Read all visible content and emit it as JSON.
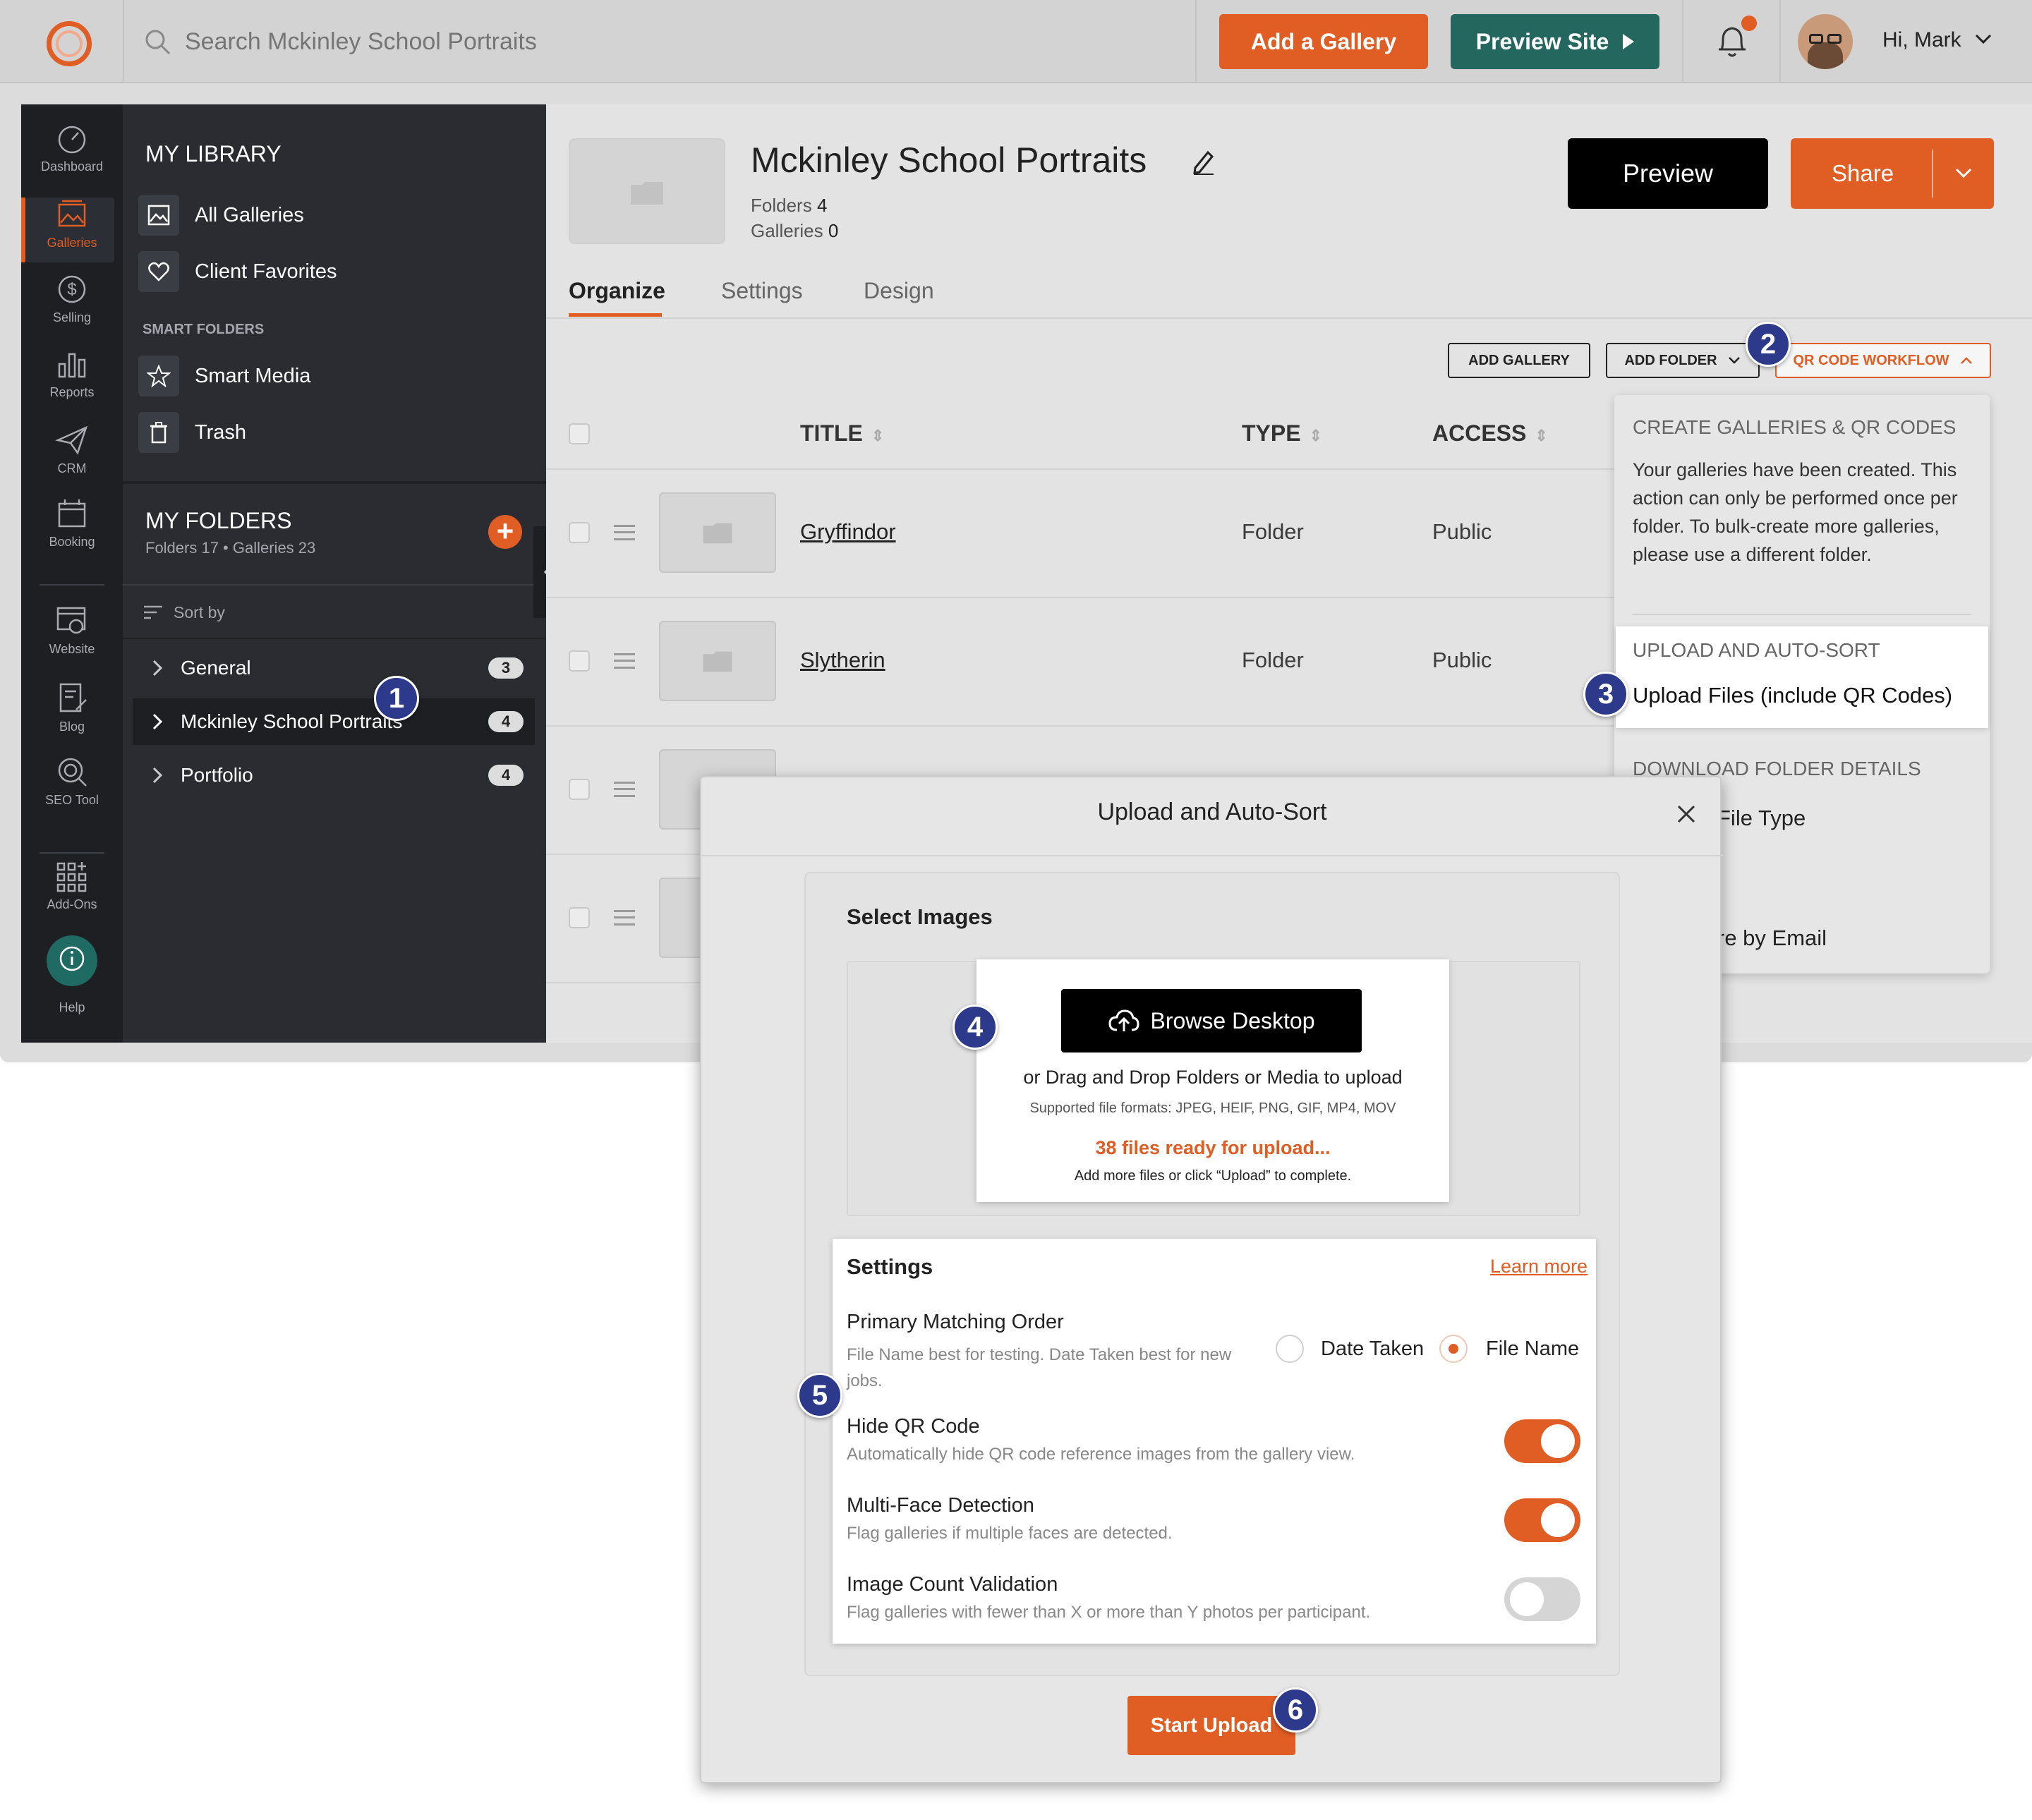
{
  "topbar": {
    "search_placeholder": "Search Mckinley School Portraits",
    "add_gallery": "Add a Gallery",
    "preview_site": "Preview Site",
    "greeting": "Hi, Mark"
  },
  "colors": {
    "accent_orange": "#e05d23",
    "teal": "#24675f",
    "navy_badge": "#2d3a8c",
    "dark_rail": "#1d1f23",
    "sidebar_bg": "#2a2c31"
  },
  "rail": [
    {
      "label": "Dashboard",
      "icon": "dashboard-icon"
    },
    {
      "label": "Galleries",
      "icon": "galleries-icon"
    },
    {
      "label": "Selling",
      "icon": "dollar-icon"
    },
    {
      "label": "Reports",
      "icon": "bar-chart-icon"
    },
    {
      "label": "CRM",
      "icon": "send-icon"
    },
    {
      "label": "Booking",
      "icon": "calendar-icon"
    },
    {
      "label": "Website",
      "icon": "website-icon"
    },
    {
      "label": "Blog",
      "icon": "blog-icon"
    },
    {
      "label": "SEO Tool",
      "icon": "seo-icon"
    },
    {
      "label": "Add-Ons",
      "icon": "add-ons-icon"
    },
    {
      "label": "Help",
      "icon": "help-icon"
    }
  ],
  "library": {
    "heading": "MY LIBRARY",
    "all_galleries": "All Galleries",
    "client_favorites": "Client Favorites",
    "smart_folders_heading": "SMART FOLDERS",
    "smart_media": "Smart Media",
    "trash": "Trash",
    "my_folders": "MY FOLDERS",
    "folders_meta": "Folders 17 • Galleries 23",
    "sort_by": "Sort by",
    "folders": [
      {
        "name": "General",
        "count": "3"
      },
      {
        "name": "Mckinley School Portraits",
        "count": "4"
      },
      {
        "name": "Portfolio",
        "count": "4"
      }
    ]
  },
  "header": {
    "title": "Mckinley School Portraits",
    "folders_label": "Folders",
    "folders_count": "4",
    "galleries_label": "Galleries",
    "galleries_count": "0",
    "preview": "Preview",
    "share": "Share",
    "tabs": [
      "Organize",
      "Settings",
      "Design"
    ]
  },
  "toolbar": {
    "add_gallery": "ADD GALLERY",
    "add_folder": "ADD FOLDER",
    "qr_workflow": "QR CODE WORKFLOW"
  },
  "table": {
    "columns": [
      "TITLE",
      "TYPE",
      "ACCESS"
    ],
    "rows": [
      {
        "title": "Gryffindor",
        "type": "Folder",
        "access": "Public"
      },
      {
        "title": "Slytherin",
        "type": "Folder",
        "access": "Public"
      }
    ]
  },
  "qr_menu": {
    "create_heading": "CREATE GALLERIES & QR CODES",
    "create_text": "Your galleries have been created. This action can only be performed once per folder. To bulk-create more galleries, please use a different folder.",
    "upload_heading": "UPLOAD AND AUTO-SORT",
    "upload_item": "Upload Files (include QR Codes)",
    "download_heading": "DOWNLOAD FOLDER DETAILS",
    "file_type_partial": "File Type",
    "share_email_partial": "re by Email"
  },
  "modal": {
    "title": "Upload and Auto-Sort",
    "select_images": "Select Images",
    "browse": "Browse Desktop",
    "drag_drop": "or Drag and Drop Folders or Media to upload",
    "formats": "Supported file formats: JPEG, HEIF, PNG, GIF, MP4, MOV",
    "ready": "38 files ready for upload...",
    "add_more": "Add more files or click “Upload” to complete.",
    "settings_heading": "Settings",
    "learn_more": "Learn more",
    "primary_order_title": "Primary Matching Order",
    "primary_order_sub": "File Name best for testing. Date Taken best for new jobs.",
    "date_taken": "Date Taken",
    "file_name": "File Name",
    "hide_qr_title": "Hide QR Code",
    "hide_qr_sub": "Automatically hide QR code reference images from the gallery view.",
    "multi_face_title": "Multi-Face Detection",
    "multi_face_sub": "Flag galleries if multiple faces are detected.",
    "image_count_title": "Image Count Validation",
    "image_count_sub": "Flag galleries with fewer than X or more than Y photos per participant.",
    "start_upload": "Start Upload"
  },
  "settings_state": {
    "matching_order_selected": "File Name",
    "hide_qr": true,
    "multi_face": true,
    "image_count": false
  },
  "badges": [
    "1",
    "2",
    "3",
    "4",
    "5",
    "6"
  ]
}
